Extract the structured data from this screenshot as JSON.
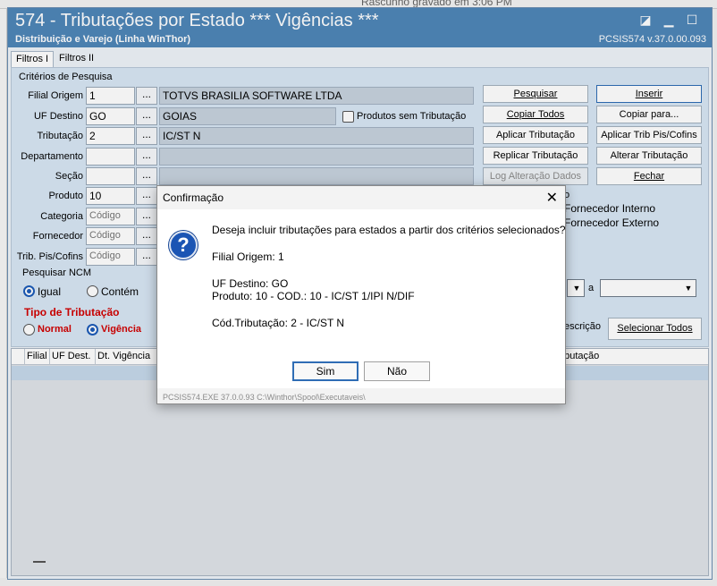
{
  "background": {
    "status_text": "Rascunho gravado em 3:06 PM"
  },
  "window": {
    "title": "574 - Tributações por Estado *** Vigências ***",
    "subtitle": "Distribuição e Varejo (Linha WinThor)",
    "version": "PCSIS574  v.37.0.00.093"
  },
  "tabs": [
    "Filtros I",
    "Filtros II"
  ],
  "filters": {
    "section_title": "Critérios de Pesquisa",
    "filial_origem": {
      "label": "Filial Origem",
      "value": "1",
      "desc": "TOTVS BRASILIA SOFTWARE LTDA"
    },
    "uf_destino": {
      "label": "UF Destino",
      "value": "GO",
      "desc": "GOIAS"
    },
    "tributacao": {
      "label": "Tributação",
      "value": "2",
      "desc": "IC/ST N"
    },
    "departamento": {
      "label": "Departamento",
      "value": ""
    },
    "secao": {
      "label": "Seção",
      "value": ""
    },
    "produto": {
      "label": "Produto",
      "value": "10"
    },
    "categoria": {
      "label": "Categoria",
      "placeholder": "Código"
    },
    "fornecedor": {
      "label": "Fornecedor",
      "placeholder": "Código"
    },
    "trib_pis": {
      "label": "Trib. Pis/Cofins",
      "placeholder": "Código"
    },
    "dots": "...",
    "produtos_sem_tributacao": "Produtos sem Tributação"
  },
  "ncm": {
    "title": "Pesquisar NCM",
    "igual": "Igual",
    "contem": "Contém"
  },
  "tipo_tributacao": {
    "title": "Tipo de Tributação",
    "normal": "Normal",
    "vigencia": "Vigência"
  },
  "buttons": {
    "pesquisar": "Pesquisar",
    "inserir": "Inserir",
    "copiar_todos": "Copiar Todos",
    "copiar_para": "Copiar para...",
    "aplicar_tributacao": "Aplicar Tributação",
    "aplicar_trib_pis": "Aplicar Trib Pis/Cofins",
    "replicar_tributacao": "Replicar Tributação",
    "alterar_tributacao": "Alterar Tributação",
    "log_alteracao": "Log Alteração Dados",
    "fechar": "Fechar",
    "selecionar_todos": "Selecionar Todos"
  },
  "fornecedor_partial": {
    "interno": "Fornecedor Interno",
    "externo": "Fornecedor Externo"
  },
  "partial": {
    "a_label": "a",
    "escricao": "escrição",
    "o_frag": "o"
  },
  "grid": {
    "columns": [
      "Filial",
      "UF Dest.",
      "Dt. Vigência",
      "ributação"
    ]
  },
  "dialog": {
    "title": "Confirmação",
    "close": "✕",
    "question": "Deseja incluir tributações para estados a partir dos critérios selecionados?",
    "line_filial": "Filial Origem: 1",
    "line_uf": "UF Destino: GO",
    "line_produto": "Produto: 10 - COD.: 10 - IC/ST 1/IPI N/DIF",
    "line_cod_trib": "Cód.Tributação: 2 - IC/ST N",
    "yes": "Sim",
    "no": "Não",
    "footer": "PCSIS574.EXE 37.0.0.93 C:\\Winthor\\Spool\\Executaveis\\"
  }
}
